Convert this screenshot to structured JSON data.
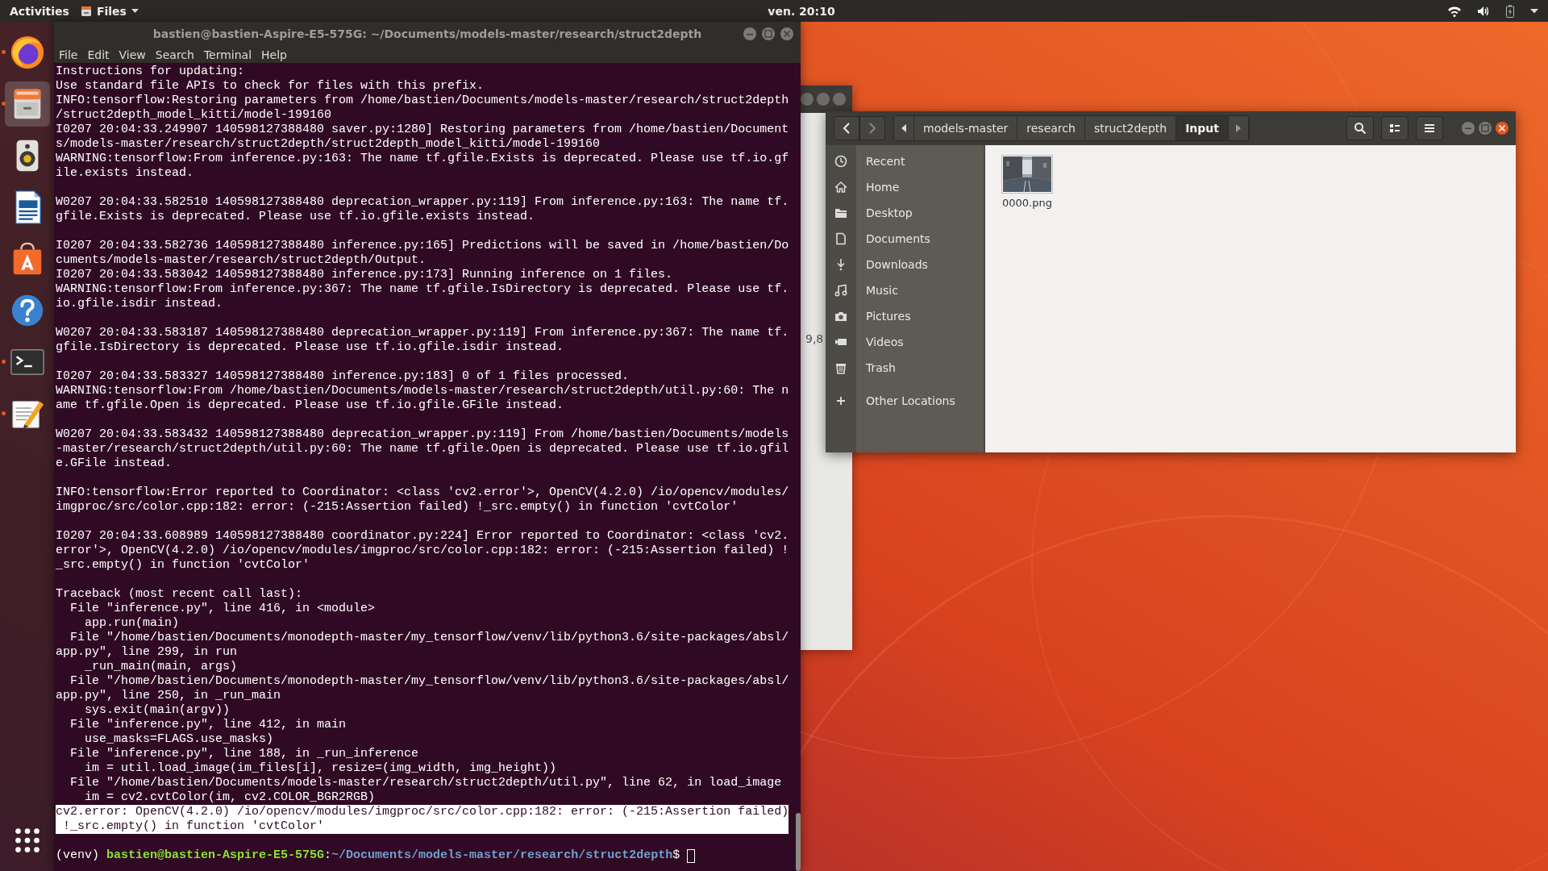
{
  "top_bar": {
    "activities": "Activities",
    "app_menu": "Files",
    "clock": "ven. 20:10"
  },
  "dock": {
    "items": [
      {
        "kind": "browser",
        "running": true,
        "selected": false
      },
      {
        "kind": "files",
        "running": true,
        "selected": true
      },
      {
        "kind": "music",
        "running": false,
        "selected": false
      },
      {
        "kind": "writer",
        "running": false,
        "selected": false
      },
      {
        "kind": "store",
        "running": false,
        "selected": false
      },
      {
        "kind": "help",
        "running": false,
        "selected": false
      },
      {
        "kind": "terminal",
        "running": true,
        "selected": false
      },
      {
        "kind": "editor",
        "running": true,
        "selected": false
      },
      {
        "kind": "apps",
        "running": false,
        "selected": false
      }
    ]
  },
  "terminal": {
    "title": "bastien@bastien-Aspire-E5-575G: ~/Documents/models-master/research/struct2depth",
    "menu": [
      "File",
      "Edit",
      "View",
      "Search",
      "Terminal",
      "Help"
    ],
    "lines": [
      {
        "kind": "output",
        "text": "Instructions for updating:"
      },
      {
        "kind": "output",
        "text": "Use standard file APIs to check for files with this prefix."
      },
      {
        "kind": "output",
        "text": "INFO:tensorflow:Restoring parameters from /home/bastien/Documents/models-master/research/struct2depth"
      },
      {
        "kind": "output",
        "text": "/struct2depth_model_kitti/model-199160"
      },
      {
        "kind": "output",
        "text": "I0207 20:04:33.249907 140598127388480 saver.py:1280] Restoring parameters from /home/bastien/Document"
      },
      {
        "kind": "output",
        "text": "s/models-master/research/struct2depth/struct2depth_model_kitti/model-199160"
      },
      {
        "kind": "output",
        "text": "WARNING:tensorflow:From inference.py:163: The name tf.gfile.Exists is deprecated. Please use tf.io.gf"
      },
      {
        "kind": "output",
        "text": "ile.exists instead."
      },
      {
        "kind": "blank"
      },
      {
        "kind": "output",
        "text": "W0207 20:04:33.582510 140598127388480 deprecation_wrapper.py:119] From inference.py:163: The name tf."
      },
      {
        "kind": "output",
        "text": "gfile.Exists is deprecated. Please use tf.io.gfile.exists instead."
      },
      {
        "kind": "blank"
      },
      {
        "kind": "output",
        "text": "I0207 20:04:33.582736 140598127388480 inference.py:165] Predictions will be saved in /home/bastien/Do"
      },
      {
        "kind": "output",
        "text": "cuments/models-master/research/struct2depth/Output."
      },
      {
        "kind": "output",
        "text": "I0207 20:04:33.583042 140598127388480 inference.py:173] Running inference on 1 files."
      },
      {
        "kind": "output",
        "text": "WARNING:tensorflow:From inference.py:367: The name tf.gfile.IsDirectory is deprecated. Please use tf."
      },
      {
        "kind": "output",
        "text": "io.gfile.isdir instead."
      },
      {
        "kind": "blank"
      },
      {
        "kind": "output",
        "text": "W0207 20:04:33.583187 140598127388480 deprecation_wrapper.py:119] From inference.py:367: The name tf."
      },
      {
        "kind": "output",
        "text": "gfile.IsDirectory is deprecated. Please use tf.io.gfile.isdir instead."
      },
      {
        "kind": "blank"
      },
      {
        "kind": "output",
        "text": "I0207 20:04:33.583327 140598127388480 inference.py:183] 0 of 1 files processed."
      },
      {
        "kind": "output",
        "text": "WARNING:tensorflow:From /home/bastien/Documents/models-master/research/struct2depth/util.py:60: The n"
      },
      {
        "kind": "output",
        "text": "ame tf.gfile.Open is deprecated. Please use tf.io.gfile.GFile instead."
      },
      {
        "kind": "blank"
      },
      {
        "kind": "output",
        "text": "W0207 20:04:33.583432 140598127388480 deprecation_wrapper.py:119] From /home/bastien/Documents/models"
      },
      {
        "kind": "output",
        "text": "-master/research/struct2depth/util.py:60: The name tf.gfile.Open is deprecated. Please use tf.io.gfil"
      },
      {
        "kind": "output",
        "text": "e.GFile instead."
      },
      {
        "kind": "blank"
      },
      {
        "kind": "output",
        "text": "INFO:tensorflow:Error reported to Coordinator: <class 'cv2.error'>, OpenCV(4.2.0) /io/opencv/modules/"
      },
      {
        "kind": "output",
        "text": "imgproc/src/color.cpp:182: error: (-215:Assertion failed) !_src.empty() in function 'cvtColor'"
      },
      {
        "kind": "blank"
      },
      {
        "kind": "output",
        "text": "I0207 20:04:33.608989 140598127388480 coordinator.py:224] Error reported to Coordinator: <class 'cv2."
      },
      {
        "kind": "output",
        "text": "error'>, OpenCV(4.2.0) /io/opencv/modules/imgproc/src/color.cpp:182: error: (-215:Assertion failed) !"
      },
      {
        "kind": "output",
        "text": "_src.empty() in function 'cvtColor'"
      },
      {
        "kind": "blank"
      },
      {
        "kind": "output",
        "text": "Traceback (most recent call last):"
      },
      {
        "kind": "output",
        "text": "  File \"inference.py\", line 416, in <module>"
      },
      {
        "kind": "output",
        "text": "    app.run(main)"
      },
      {
        "kind": "output",
        "text": "  File \"/home/bastien/Documents/monodepth-master/my_tensorflow/venv/lib/python3.6/site-packages/absl/"
      },
      {
        "kind": "output",
        "text": "app.py\", line 299, in run"
      },
      {
        "kind": "output",
        "text": "    _run_main(main, args)"
      },
      {
        "kind": "output",
        "text": "  File \"/home/bastien/Documents/monodepth-master/my_tensorflow/venv/lib/python3.6/site-packages/absl/"
      },
      {
        "kind": "output",
        "text": "app.py\", line 250, in _run_main"
      },
      {
        "kind": "output",
        "text": "    sys.exit(main(argv))"
      },
      {
        "kind": "output",
        "text": "  File \"inference.py\", line 412, in main"
      },
      {
        "kind": "output",
        "text": "    use_masks=FLAGS.use_masks)"
      },
      {
        "kind": "output",
        "text": "  File \"inference.py\", line 188, in _run_inference"
      },
      {
        "kind": "output",
        "text": "    im = util.load_image(im_files[i], resize=(img_width, img_height))"
      },
      {
        "kind": "output",
        "text": "  File \"/home/bastien/Documents/models-master/research/struct2depth/util.py\", line 62, in load_image"
      },
      {
        "kind": "output",
        "text": "    im = cv2.cvtColor(im, cv2.COLOR_BGR2RGB)"
      },
      {
        "kind": "highlight",
        "text": "cv2.error: OpenCV(4.2.0) /io/opencv/modules/imgproc/src/color.cpp:182: error: (-215:Assertion failed)"
      },
      {
        "kind": "highlight",
        "text": " !_src.empty() in function 'cvtColor'"
      },
      {
        "kind": "blank"
      }
    ],
    "prompt": {
      "env": "(venv)",
      "user": "bastien@bastien-Aspire-E5-575G",
      "separator": ":",
      "path": "~/Documents/models-master/research/struct2depth",
      "symbol": "$"
    }
  },
  "back_window": {
    "size_text": "9,8"
  },
  "files": {
    "path": [
      {
        "label": "models-master",
        "selected": false
      },
      {
        "label": "research",
        "selected": false
      },
      {
        "label": "struct2depth",
        "selected": false
      },
      {
        "label": "Input",
        "selected": true
      }
    ],
    "sidebar": [
      {
        "kind": "recent",
        "label": "Recent"
      },
      {
        "kind": "home",
        "label": "Home"
      },
      {
        "kind": "desktop",
        "label": "Desktop"
      },
      {
        "kind": "documents",
        "label": "Documents"
      },
      {
        "kind": "downloads",
        "label": "Downloads"
      },
      {
        "kind": "music",
        "label": "Music"
      },
      {
        "kind": "pictures",
        "label": "Pictures"
      },
      {
        "kind": "videos",
        "label": "Videos"
      },
      {
        "kind": "trash",
        "label": "Trash"
      },
      {
        "kind": "other",
        "label": "Other Locations"
      }
    ],
    "items": [
      {
        "kind": "picture",
        "name": "0000.png"
      }
    ]
  }
}
